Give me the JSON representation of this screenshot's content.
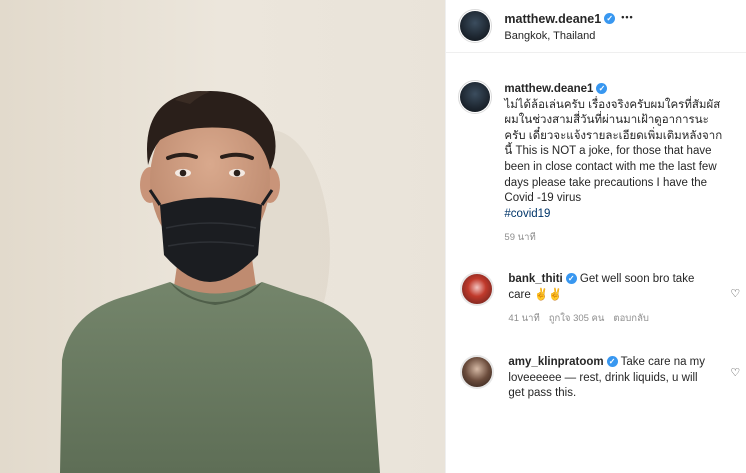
{
  "post": {
    "image_alt": "",
    "header": {
      "username": "matthew.deane1",
      "location": "Bangkok, Thailand",
      "more": "•••"
    },
    "caption": {
      "username": "matthew.deane1",
      "text": "ไม่ได้ล้อเล่นครับ เรื่องจริงครับผมใครที่สัมผัสผมในช่วงสามสี่วันที่ผ่านมาเฝ้าดูอาการนะครับ เดี๋ยวจะแจ้งรายละเอียดเพิ่มเติมหลังจากนี้ This is NOT a joke, for those that have been in close contact with me the last few days please take precautions I have the Covid -19 virus",
      "hashtag": "#covid19",
      "time": "59 นาที"
    },
    "comments": [
      {
        "username": "bank_thiti",
        "text": "Get well soon bro take care ✌✌",
        "time": "41 นาที",
        "likes": "ถูกใจ 305 คน",
        "reply": "ตอบกลับ"
      },
      {
        "username": "amy_klinpratoom",
        "text": "Take care na my loveeeeee — rest, drink liquids, u will get pass this.",
        "time": "",
        "likes": "",
        "reply": ""
      }
    ],
    "colors": {
      "verified": "#3897f0",
      "hashtag": "#003569",
      "muted": "#8e8e8e",
      "mask": "#1b1d21",
      "shirt": "#6c7d62"
    },
    "icons": {
      "verified": "verified-badge-icon",
      "like": "heart-icon",
      "more": "more-options-icon"
    }
  }
}
